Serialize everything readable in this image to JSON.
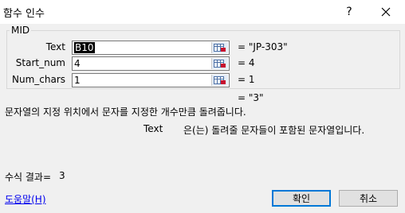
{
  "window": {
    "title": "함수 인수",
    "help_glyph": "?",
    "close_icon": "close-icon"
  },
  "function_group": {
    "name": "MID"
  },
  "arguments": [
    {
      "label": "Text",
      "value": "B10",
      "result": "=  \"JP-303\""
    },
    {
      "label": "Start_num",
      "value": "4",
      "result": "=  4"
    },
    {
      "label": "Num_chars",
      "value": "1",
      "result": "=  1"
    }
  ],
  "function_result": "=  \"3\"",
  "description": "문자열의 지정 위치에서 문자를 지정한 개수만큼 돌려줍니다.",
  "argument_help": {
    "name": "Text",
    "text": "은(는) 돌려줄 문자들이 포함된 문자열입니다."
  },
  "formula_result": {
    "label": "수식 결과=",
    "value": "3"
  },
  "buttons": {
    "help_link": "도움말(H)",
    "ok": "확인",
    "cancel": "취소"
  },
  "colors": {
    "dialog_bg": "#f0f0f0",
    "accent": "#0078d7",
    "link": "#0000ee"
  }
}
